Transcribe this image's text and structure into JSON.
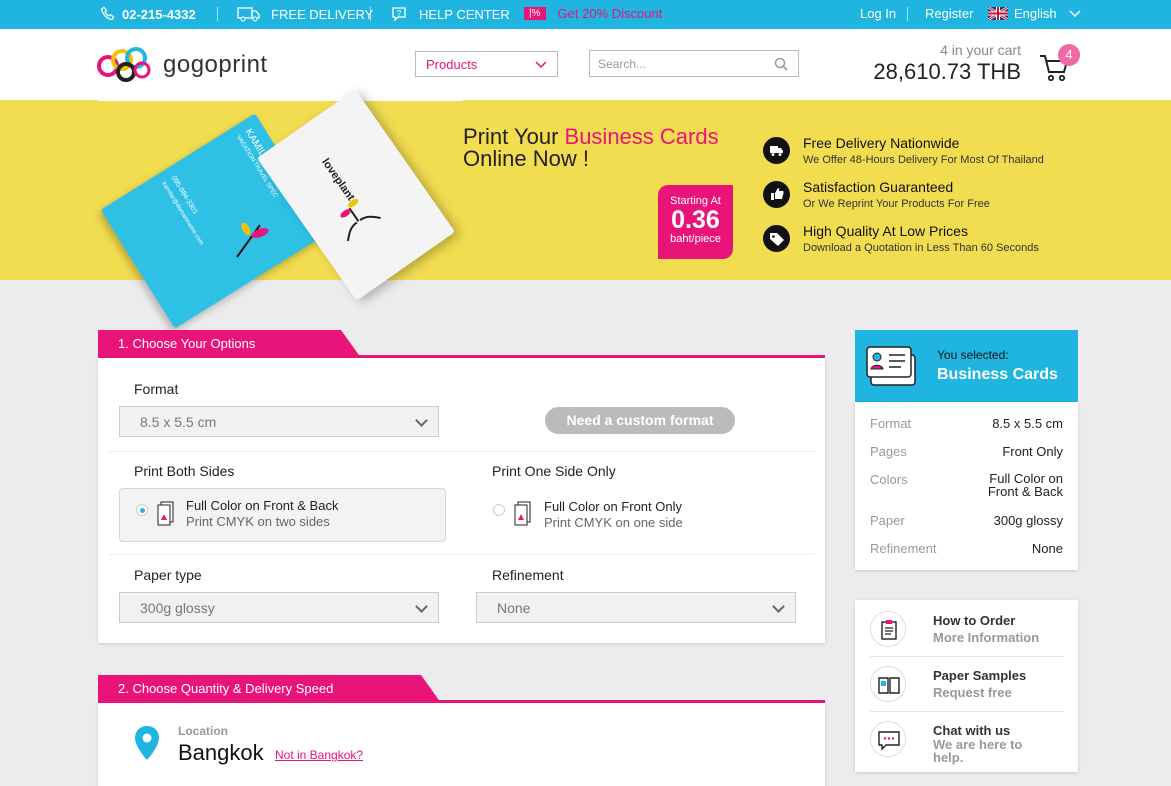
{
  "topbar": {
    "phone": "02-215-4332",
    "free_delivery": "FREE DELIVERY",
    "help_center": "HELP CENTER",
    "discount_badge": "|%",
    "discount": "Get 20% Discount",
    "login": "Log In",
    "register": "Register",
    "language": "English"
  },
  "header": {
    "logo_text": "gogoprint",
    "products_label": "Products",
    "search_placeholder": "Search...",
    "cart_count_text": "4 in your cart",
    "cart_total": "28,610.73 THB",
    "cart_badge": "4"
  },
  "banner": {
    "title_prefix": "Print Your ",
    "title_highlight": "Business Cards",
    "title_line2": "Online Now !",
    "price_label": "Starting At",
    "price_value": "0.36",
    "price_unit": "baht/piece",
    "card1_name": "KAMILAR PE",
    "card1_sub": "VACATION TRAVEL SPEC",
    "card1_phone": "095-884-3301",
    "card1_email": "kamilar@domainname.com",
    "card2_brand": "loveplant",
    "features": [
      {
        "title": "Free Delivery Nationwide",
        "subtitle": "We Offer 48-Hours Delivery For Most Of Thailand",
        "icon": "truck-icon"
      },
      {
        "title": "Satisfaction Guaranteed",
        "subtitle": "Or We Reprint Your Products For Free",
        "icon": "thumbs-up-icon"
      },
      {
        "title": "High Quality At Low Prices",
        "subtitle": "Download a Quotation in Less Than 60 Seconds",
        "icon": "tag-icon"
      }
    ]
  },
  "options": {
    "tab_label": "1. Choose Your Options",
    "format_label": "Format",
    "format_value": "8.5 x 5.5 cm",
    "custom_format_button": "Need a custom format",
    "both_sides_label": "Print Both Sides",
    "one_side_label": "Print One Side Only",
    "both_option_title": "Full Color on Front & Back",
    "both_option_sub": "Print CMYK on two sides",
    "one_option_title": "Full Color on Front Only",
    "one_option_sub": "Print CMYK on one side",
    "paper_label": "Paper type",
    "paper_value": "300g glossy",
    "refinement_label": "Refinement",
    "refinement_value": "None"
  },
  "quantity": {
    "tab_label": "2. Choose Quantity & Delivery Speed",
    "location_label": "Location",
    "location_value": "Bangkok",
    "not_in_link": "Not in Bangkok?"
  },
  "summary": {
    "selected_label": "You selected:",
    "product": "Business Cards",
    "rows": [
      {
        "key": "Format",
        "value": "8.5 x 5.5 cm"
      },
      {
        "key": "Pages",
        "value": "Front Only"
      },
      {
        "key": "Colors",
        "value": "Full Color on Front & Back"
      },
      {
        "key": "Paper",
        "value": "300g glossy"
      },
      {
        "key": "Refinement",
        "value": "None"
      }
    ]
  },
  "help": [
    {
      "title": "How to Order",
      "subtitle": "More Information",
      "icon": "clipboard-icon"
    },
    {
      "title": "Paper Samples",
      "subtitle": "Request free",
      "icon": "book-icon"
    },
    {
      "title": "Chat with us",
      "subtitle": "We are here to help.",
      "icon": "chat-icon"
    }
  ],
  "colors": {
    "accent_blue": "#1fb5e0",
    "accent_pink": "#e8147a",
    "banner_yellow": "#f2dc50"
  }
}
